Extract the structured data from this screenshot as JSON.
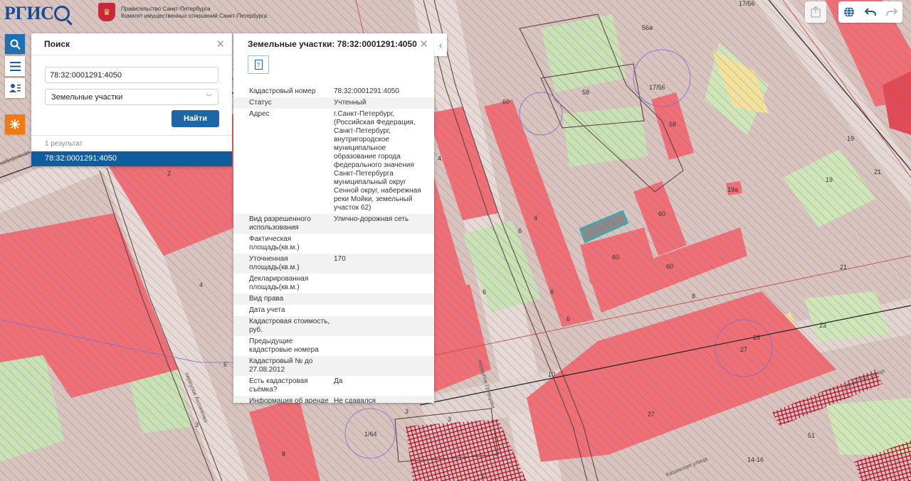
{
  "header": {
    "logo_text": "РГИС",
    "gov_line1": "Правительство Санкт-Петербурга",
    "gov_line2": "Комитет имущественных отношений Санкт-Петербурга"
  },
  "toolbar_left": {
    "icons": [
      "search-icon",
      "menu-icon",
      "user-list-icon",
      "emblem-icon"
    ]
  },
  "toolbar_right": {
    "icons": [
      "export-icon",
      "globe-icon",
      "undo-icon",
      "redo-icon"
    ]
  },
  "search": {
    "title": "Поиск",
    "query": "78:32:0001291:4050",
    "type_selected": "Земельные участки",
    "find_label": "Найти",
    "result_count": "1 результат",
    "results": [
      "78:32:0001291:4050"
    ]
  },
  "info": {
    "title": "Земельные участки: 78:32:0001291:4050",
    "rows": [
      {
        "key": "Кадастровый номер",
        "value": "78:32:0001291:4050"
      },
      {
        "key": "Статус",
        "value": "Учтенный"
      },
      {
        "key": "Адрес",
        "value": "г.Санкт-Петербург, (Российская Федерация, Санкт-Петербург, внутригородское муниципальное образование города федерального значения Санкт-Петербурга муниципальный округ Сенной округ, набережная реки Мойки, земельный участок 62)"
      },
      {
        "key": "Вид разрешенного использования",
        "value": "Улично-дорожная сеть"
      },
      {
        "key": "Фактическая площадь(кв.м.)",
        "value": ""
      },
      {
        "key": "Уточненная площадь(кв.м.)",
        "value": "170"
      },
      {
        "key": "Декларированная площадь(кв.м.)",
        "value": ""
      },
      {
        "key": "Вид права",
        "value": ""
      },
      {
        "key": "Дата учета",
        "value": ""
      },
      {
        "key": "Кадастровая стоимость, руб.",
        "value": ""
      },
      {
        "key": "Предыдущие кадастровые номера",
        "value": ""
      },
      {
        "key": "Кадастровый № до 27.08.2012",
        "value": ""
      },
      {
        "key": "Есть кадастровая съёмка?",
        "value": "Да"
      },
      {
        "key": "Информация об аренде",
        "value": "Не сдавался"
      }
    ]
  },
  "map": {
    "labels": [
      "56а",
      "58",
      "17/56",
      "60",
      "58",
      "17/56",
      "19",
      "21",
      "19",
      "19а",
      "60",
      "60",
      "60",
      "4",
      "6",
      "4",
      "6",
      "6",
      "6",
      "8",
      "21",
      "23",
      "25",
      "27",
      "10",
      "27",
      "51",
      "2",
      "4",
      "6",
      "3",
      "8",
      "1/64",
      "3",
      "3",
      "5",
      "14-16"
    ],
    "streets": [
      "набережная реки Мойки",
      "переулок Антоненко",
      "переулок Гривцова",
      "Казанская улица",
      "Казанская улица"
    ],
    "colors": {
      "building": "#ef6f74",
      "parcel": "#d8c2bc",
      "green": "#c9e2b4",
      "hatch": "#7b6fa8"
    }
  }
}
